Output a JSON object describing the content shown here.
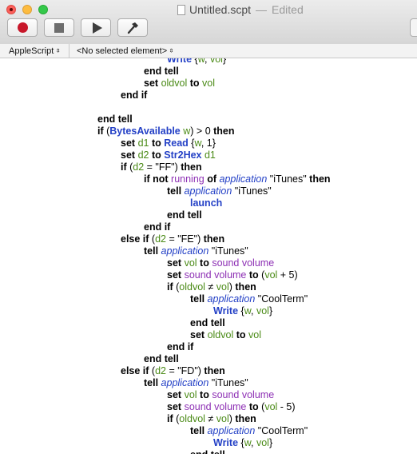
{
  "window": {
    "title": "Untitled.scpt",
    "separator": "—",
    "edited": "Edited"
  },
  "toolbar": {
    "record": "record-icon",
    "stop": "stop-icon",
    "run": "run-icon",
    "compile": "compile-icon"
  },
  "navbar": {
    "language": "AppleScript",
    "element": "<No selected element>"
  },
  "script": [
    {
      "indent": 3,
      "tokens": [
        {
          "t": "Write",
          "k": "cmd"
        },
        {
          "t": " {",
          "k": "op"
        },
        {
          "t": "w",
          "k": "var"
        },
        {
          "t": ", ",
          "k": "op"
        },
        {
          "t": "vol",
          "k": "var"
        },
        {
          "t": "}",
          "k": "op"
        }
      ]
    },
    {
      "indent": 2,
      "tokens": [
        {
          "t": "end tell",
          "k": "kw"
        }
      ]
    },
    {
      "indent": 2,
      "tokens": [
        {
          "t": "set",
          "k": "kw"
        },
        {
          "t": " ",
          "k": "op"
        },
        {
          "t": "oldvol",
          "k": "var"
        },
        {
          "t": " ",
          "k": "op"
        },
        {
          "t": "to",
          "k": "kw"
        },
        {
          "t": " ",
          "k": "op"
        },
        {
          "t": "vol",
          "k": "var"
        }
      ]
    },
    {
      "indent": 1,
      "tokens": [
        {
          "t": "end if",
          "k": "kw"
        }
      ]
    },
    {
      "indent": 0,
      "tokens": []
    },
    {
      "indent": 0,
      "tokens": [
        {
          "t": "end tell",
          "k": "kw"
        }
      ]
    },
    {
      "indent": 0,
      "tokens": [
        {
          "t": "if",
          "k": "kw"
        },
        {
          "t": " (",
          "k": "op"
        },
        {
          "t": "BytesAvailable",
          "k": "cmd"
        },
        {
          "t": " ",
          "k": "op"
        },
        {
          "t": "w",
          "k": "var"
        },
        {
          "t": ") > 0 ",
          "k": "op"
        },
        {
          "t": "then",
          "k": "kw"
        }
      ]
    },
    {
      "indent": 1,
      "tokens": [
        {
          "t": "set",
          "k": "kw"
        },
        {
          "t": " ",
          "k": "op"
        },
        {
          "t": "d1",
          "k": "var"
        },
        {
          "t": " ",
          "k": "op"
        },
        {
          "t": "to",
          "k": "kw"
        },
        {
          "t": " ",
          "k": "op"
        },
        {
          "t": "Read",
          "k": "cmd"
        },
        {
          "t": " {",
          "k": "op"
        },
        {
          "t": "w",
          "k": "var"
        },
        {
          "t": ", 1}",
          "k": "op"
        }
      ]
    },
    {
      "indent": 1,
      "tokens": [
        {
          "t": "set",
          "k": "kw"
        },
        {
          "t": " ",
          "k": "op"
        },
        {
          "t": "d2",
          "k": "var"
        },
        {
          "t": " ",
          "k": "op"
        },
        {
          "t": "to",
          "k": "kw"
        },
        {
          "t": " ",
          "k": "op"
        },
        {
          "t": "Str2Hex",
          "k": "cmd"
        },
        {
          "t": " ",
          "k": "op"
        },
        {
          "t": "d1",
          "k": "var"
        }
      ]
    },
    {
      "indent": 1,
      "tokens": [
        {
          "t": "if",
          "k": "kw"
        },
        {
          "t": " (",
          "k": "op"
        },
        {
          "t": "d2",
          "k": "var"
        },
        {
          "t": " = \"FF\") ",
          "k": "op"
        },
        {
          "t": "then",
          "k": "kw"
        }
      ]
    },
    {
      "indent": 2,
      "tokens": [
        {
          "t": "if not",
          "k": "kw"
        },
        {
          "t": " ",
          "k": "op"
        },
        {
          "t": "running",
          "k": "prop"
        },
        {
          "t": " ",
          "k": "op"
        },
        {
          "t": "of",
          "k": "kw"
        },
        {
          "t": " ",
          "k": "op"
        },
        {
          "t": "application",
          "k": "app"
        },
        {
          "t": " \"iTunes\" ",
          "k": "op"
        },
        {
          "t": "then",
          "k": "kw"
        }
      ]
    },
    {
      "indent": 3,
      "tokens": [
        {
          "t": "tell",
          "k": "kw"
        },
        {
          "t": " ",
          "k": "op"
        },
        {
          "t": "application",
          "k": "app"
        },
        {
          "t": " \"iTunes\"",
          "k": "op"
        }
      ]
    },
    {
      "indent": 4,
      "tokens": [
        {
          "t": "launch",
          "k": "cmd"
        }
      ]
    },
    {
      "indent": 3,
      "tokens": [
        {
          "t": "end tell",
          "k": "kw"
        }
      ]
    },
    {
      "indent": 2,
      "tokens": [
        {
          "t": "end if",
          "k": "kw"
        }
      ]
    },
    {
      "indent": 1,
      "tokens": [
        {
          "t": "else if",
          "k": "kw"
        },
        {
          "t": " (",
          "k": "op"
        },
        {
          "t": "d2",
          "k": "var"
        },
        {
          "t": " = \"FE\") ",
          "k": "op"
        },
        {
          "t": "then",
          "k": "kw"
        }
      ]
    },
    {
      "indent": 2,
      "tokens": [
        {
          "t": "tell",
          "k": "kw"
        },
        {
          "t": " ",
          "k": "op"
        },
        {
          "t": "application",
          "k": "app"
        },
        {
          "t": " \"iTunes\"",
          "k": "op"
        }
      ]
    },
    {
      "indent": 3,
      "tokens": [
        {
          "t": "set",
          "k": "kw"
        },
        {
          "t": " ",
          "k": "op"
        },
        {
          "t": "vol",
          "k": "var"
        },
        {
          "t": " ",
          "k": "op"
        },
        {
          "t": "to",
          "k": "kw"
        },
        {
          "t": " ",
          "k": "op"
        },
        {
          "t": "sound volume",
          "k": "prop"
        }
      ]
    },
    {
      "indent": 3,
      "tokens": [
        {
          "t": "set",
          "k": "kw"
        },
        {
          "t": " ",
          "k": "op"
        },
        {
          "t": "sound volume",
          "k": "prop"
        },
        {
          "t": " ",
          "k": "op"
        },
        {
          "t": "to",
          "k": "kw"
        },
        {
          "t": " (",
          "k": "op"
        },
        {
          "t": "vol",
          "k": "var"
        },
        {
          "t": " + 5)",
          "k": "op"
        }
      ]
    },
    {
      "indent": 3,
      "tokens": [
        {
          "t": "if",
          "k": "kw"
        },
        {
          "t": " (",
          "k": "op"
        },
        {
          "t": "oldvol",
          "k": "var"
        },
        {
          "t": " ≠ ",
          "k": "op"
        },
        {
          "t": "vol",
          "k": "var"
        },
        {
          "t": ") ",
          "k": "op"
        },
        {
          "t": "then",
          "k": "kw"
        }
      ]
    },
    {
      "indent": 4,
      "tokens": [
        {
          "t": "tell",
          "k": "kw"
        },
        {
          "t": " ",
          "k": "op"
        },
        {
          "t": "application",
          "k": "app"
        },
        {
          "t": " \"CoolTerm\"",
          "k": "op"
        }
      ]
    },
    {
      "indent": 5,
      "tokens": [
        {
          "t": "Write",
          "k": "cmd"
        },
        {
          "t": " {",
          "k": "op"
        },
        {
          "t": "w",
          "k": "var"
        },
        {
          "t": ", ",
          "k": "op"
        },
        {
          "t": "vol",
          "k": "var"
        },
        {
          "t": "}",
          "k": "op"
        }
      ]
    },
    {
      "indent": 4,
      "tokens": [
        {
          "t": "end tell",
          "k": "kw"
        }
      ]
    },
    {
      "indent": 4,
      "tokens": [
        {
          "t": "set",
          "k": "kw"
        },
        {
          "t": " ",
          "k": "op"
        },
        {
          "t": "oldvol",
          "k": "var"
        },
        {
          "t": " ",
          "k": "op"
        },
        {
          "t": "to",
          "k": "kw"
        },
        {
          "t": " ",
          "k": "op"
        },
        {
          "t": "vol",
          "k": "var"
        }
      ]
    },
    {
      "indent": 3,
      "tokens": [
        {
          "t": "end if",
          "k": "kw"
        }
      ]
    },
    {
      "indent": 2,
      "tokens": [
        {
          "t": "end tell",
          "k": "kw"
        }
      ]
    },
    {
      "indent": 1,
      "tokens": [
        {
          "t": "else if",
          "k": "kw"
        },
        {
          "t": " (",
          "k": "op"
        },
        {
          "t": "d2",
          "k": "var"
        },
        {
          "t": " = \"FD\") ",
          "k": "op"
        },
        {
          "t": "then",
          "k": "kw"
        }
      ]
    },
    {
      "indent": 2,
      "tokens": [
        {
          "t": "tell",
          "k": "kw"
        },
        {
          "t": " ",
          "k": "op"
        },
        {
          "t": "application",
          "k": "app"
        },
        {
          "t": " \"iTunes\"",
          "k": "op"
        }
      ]
    },
    {
      "indent": 3,
      "tokens": [
        {
          "t": "set",
          "k": "kw"
        },
        {
          "t": " ",
          "k": "op"
        },
        {
          "t": "vol",
          "k": "var"
        },
        {
          "t": " ",
          "k": "op"
        },
        {
          "t": "to",
          "k": "kw"
        },
        {
          "t": " ",
          "k": "op"
        },
        {
          "t": "sound volume",
          "k": "prop"
        }
      ]
    },
    {
      "indent": 3,
      "tokens": [
        {
          "t": "set",
          "k": "kw"
        },
        {
          "t": " ",
          "k": "op"
        },
        {
          "t": "sound volume",
          "k": "prop"
        },
        {
          "t": " ",
          "k": "op"
        },
        {
          "t": "to",
          "k": "kw"
        },
        {
          "t": " (",
          "k": "op"
        },
        {
          "t": "vol",
          "k": "var"
        },
        {
          "t": " - 5)",
          "k": "op"
        }
      ]
    },
    {
      "indent": 3,
      "tokens": [
        {
          "t": "if",
          "k": "kw"
        },
        {
          "t": " (",
          "k": "op"
        },
        {
          "t": "oldvol",
          "k": "var"
        },
        {
          "t": " ≠ ",
          "k": "op"
        },
        {
          "t": "vol",
          "k": "var"
        },
        {
          "t": ") ",
          "k": "op"
        },
        {
          "t": "then",
          "k": "kw"
        }
      ]
    },
    {
      "indent": 4,
      "tokens": [
        {
          "t": "tell",
          "k": "kw"
        },
        {
          "t": " ",
          "k": "op"
        },
        {
          "t": "application",
          "k": "app"
        },
        {
          "t": " \"CoolTerm\"",
          "k": "op"
        }
      ]
    },
    {
      "indent": 5,
      "tokens": [
        {
          "t": "Write",
          "k": "cmd"
        },
        {
          "t": " {",
          "k": "op"
        },
        {
          "t": "w",
          "k": "var"
        },
        {
          "t": ", ",
          "k": "op"
        },
        {
          "t": "vol",
          "k": "var"
        },
        {
          "t": "}",
          "k": "op"
        }
      ]
    },
    {
      "indent": 4,
      "tokens": [
        {
          "t": "end tell",
          "k": "kw"
        }
      ]
    }
  ]
}
